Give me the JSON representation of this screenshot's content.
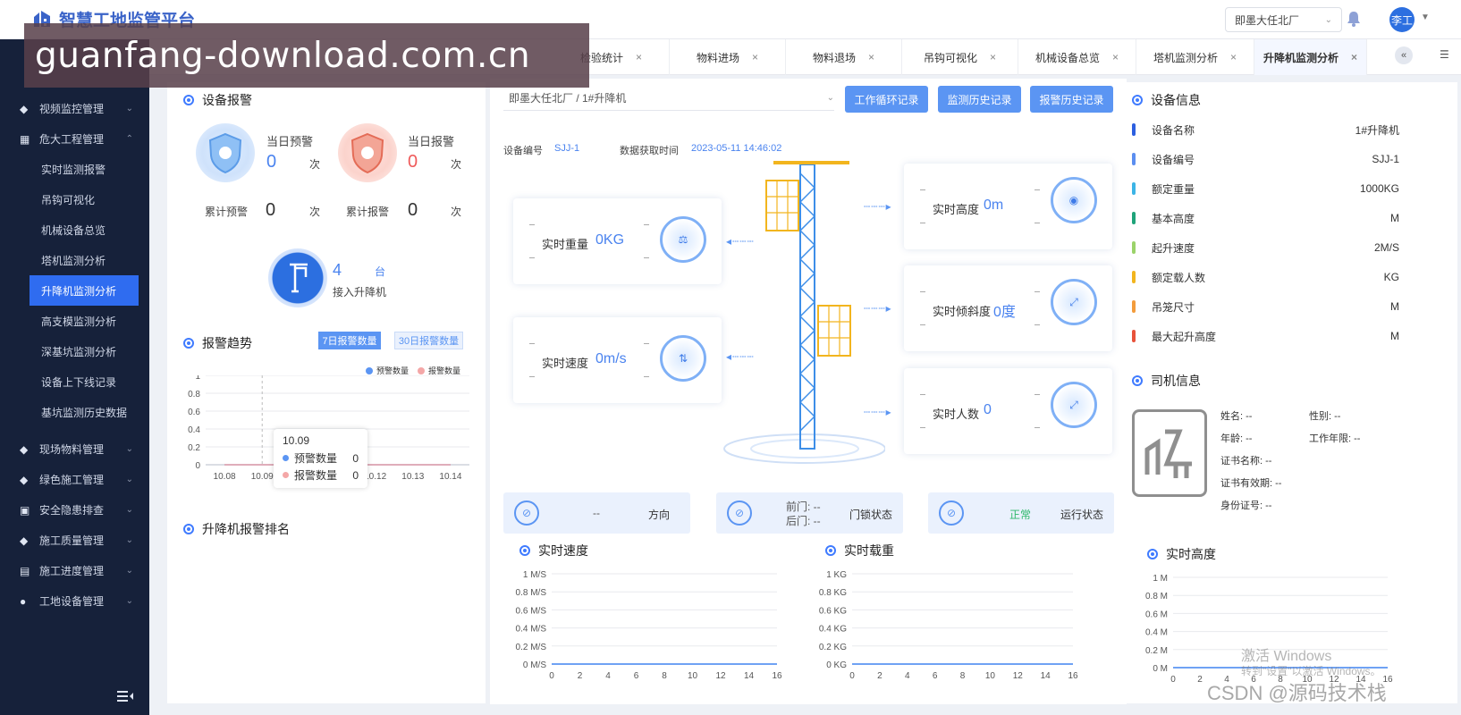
{
  "app": {
    "title": "智慧工地监管平台"
  },
  "header": {
    "project_select": "即墨大任北厂",
    "user": "李工"
  },
  "watermark": "guanfang-download.com.cn",
  "sidebar": {
    "items": [
      {
        "label": "视频监控管理",
        "expanded": false
      },
      {
        "label": "危大工程管理",
        "expanded": true
      },
      {
        "label": "现场物料管理",
        "expanded": false
      },
      {
        "label": "绿色施工管理",
        "expanded": false
      },
      {
        "label": "安全隐患排查",
        "expanded": false
      },
      {
        "label": "施工质量管理",
        "expanded": false
      },
      {
        "label": "施工进度管理",
        "expanded": false
      },
      {
        "label": "工地设备管理",
        "expanded": false
      }
    ],
    "sub_items": [
      "实时监测报警",
      "吊钩可视化",
      "机械设备总览",
      "塔机监测分析",
      "升降机监测分析",
      "高支模监测分析",
      "深基坑监测分析",
      "设备上下线记录",
      "基坑监测历史数据"
    ],
    "active_sub": "升降机监测分析"
  },
  "tabs": [
    "检验统计",
    "物料进场",
    "物料退场",
    "吊钩可视化",
    "机械设备总览",
    "塔机监测分析",
    "升降机监测分析"
  ],
  "active_tab": "升降机监测分析",
  "left": {
    "alarm_title": "设备报警",
    "today_warning_label": "当日预警",
    "today_warning_value": "0",
    "today_warning_unit": "次",
    "today_alarm_label": "当日报警",
    "today_alarm_value": "0",
    "today_alarm_unit": "次",
    "total_warning_label": "累计预警",
    "total_warning_value": "0",
    "total_warning_unit": "次",
    "total_alarm_label": "累计报警",
    "total_alarm_value": "0",
    "total_alarm_unit": "次",
    "connected_count": "4",
    "connected_unit": "台",
    "connected_label": "接入升降机",
    "trend_title": "报警趋势",
    "trend_btn_7": "7日报警数量",
    "trend_btn_30": "30日报警数量",
    "legend_warning": "预警数量",
    "legend_alarm": "报警数量",
    "tooltip": {
      "date": "10.09",
      "warning_label": "预警数量",
      "warning_value": "0",
      "alarm_label": "报警数量",
      "alarm_value": "0"
    },
    "rank_title": "升降机报警排名"
  },
  "middle": {
    "breadcrumb": "即墨大任北厂 / 1#升降机",
    "btn_work": "工作循环记录",
    "btn_history": "监测历史记录",
    "btn_alarm": "报警历史记录",
    "device_no_label": "设备编号",
    "device_no_value": "SJJ-1",
    "time_label": "数据获取时间",
    "time_value": "2023-05-11 14:46:02",
    "weight_label": "实时重量",
    "weight_value": "0KG",
    "speed_label": "实时速度",
    "speed_value": "0m/s",
    "height_label": "实时高度",
    "height_value": "0m",
    "tilt_label": "实时倾斜度",
    "tilt_value": "0度",
    "people_label": "实时人数",
    "people_value": "0",
    "dir_value": "--",
    "dir_label": "方向",
    "front_door": "前门: --",
    "back_door": "后门: --",
    "door_label": "门锁状态",
    "run_value": "正常",
    "run_label": "运行状态",
    "speed_chart_title": "实时速度",
    "load_chart_title": "实时载重"
  },
  "right": {
    "device_title": "设备信息",
    "device_rows": [
      {
        "k": "设备名称",
        "v": "1#升降机",
        "color": "#2c5fe0"
      },
      {
        "k": "设备编号",
        "v": "SJJ-1",
        "color": "#5b8ef0"
      },
      {
        "k": "额定重量",
        "v": "1000KG",
        "color": "#3cb4e6"
      },
      {
        "k": "基本高度",
        "v": "M",
        "color": "#1fa37a"
      },
      {
        "k": "起升速度",
        "v": "2M/S",
        "color": "#9bd36a"
      },
      {
        "k": "额定载人数",
        "v": "KG",
        "color": "#f2b51e"
      },
      {
        "k": "吊笼尺寸",
        "v": "M",
        "color": "#f39c3c"
      },
      {
        "k": "最大起升高度",
        "v": "M",
        "color": "#e8533a"
      }
    ],
    "driver_title": "司机信息",
    "driver": {
      "name": "姓名: --",
      "gender": "性别: --",
      "age": "年龄: --",
      "years": "工作年限: --",
      "cert_name": "证书名称: --",
      "cert_valid": "证书有效期: --",
      "id_no": "身份证号: --"
    },
    "height_chart_title": "实时高度"
  },
  "os_watermark": {
    "line1": "激活 Windows",
    "line2": "转到\"设置\"以激活 Windows。",
    "credit": "CSDN @源码技术栈"
  },
  "chart_data": [
    {
      "type": "line",
      "title": "报警趋势",
      "categories": [
        "10.08",
        "10.09",
        "10.10",
        "10.11",
        "10.12",
        "10.13",
        "10.14"
      ],
      "series": [
        {
          "name": "预警数量",
          "values": [
            0,
            0,
            0,
            0,
            0,
            0,
            0
          ]
        },
        {
          "name": "报警数量",
          "values": [
            0,
            0,
            0,
            0,
            0,
            0,
            0
          ]
        }
      ],
      "ylim": [
        0,
        1
      ],
      "yticks": [
        "0",
        "0.2",
        "0.4",
        "0.6",
        "0.8",
        "1"
      ],
      "legend": "top-right",
      "grid": true
    },
    {
      "type": "line",
      "title": "实时速度",
      "x": [
        0,
        2,
        4,
        6,
        8,
        10,
        12,
        14,
        16
      ],
      "yticks": [
        "0 M/S",
        "0.2 M/S",
        "0.4 M/S",
        "0.6 M/S",
        "0.8 M/S",
        "1 M/S"
      ],
      "ylim": [
        0,
        1
      ],
      "series": [
        {
          "values": [
            0,
            0,
            0,
            0,
            0,
            0,
            0,
            0,
            0
          ]
        }
      ]
    },
    {
      "type": "line",
      "title": "实时载重",
      "x": [
        0,
        2,
        4,
        6,
        8,
        10,
        12,
        14,
        16
      ],
      "yticks": [
        "0 KG",
        "0.2 KG",
        "0.4 KG",
        "0.6 KG",
        "0.8 KG",
        "1 KG"
      ],
      "ylim": [
        0,
        1
      ],
      "series": [
        {
          "values": [
            0,
            0,
            0,
            0,
            0,
            0,
            0,
            0,
            0
          ]
        }
      ]
    },
    {
      "type": "line",
      "title": "实时高度",
      "x": [
        0,
        2,
        4,
        6,
        8,
        10,
        12,
        14,
        16
      ],
      "yticks": [
        "0 M",
        "0.2 M",
        "0.4 M",
        "0.6 M",
        "0.8 M",
        "1 M"
      ],
      "ylim": [
        0,
        1
      ],
      "series": [
        {
          "values": [
            0,
            0,
            0,
            0,
            0,
            0,
            0,
            0,
            0
          ]
        }
      ]
    }
  ]
}
